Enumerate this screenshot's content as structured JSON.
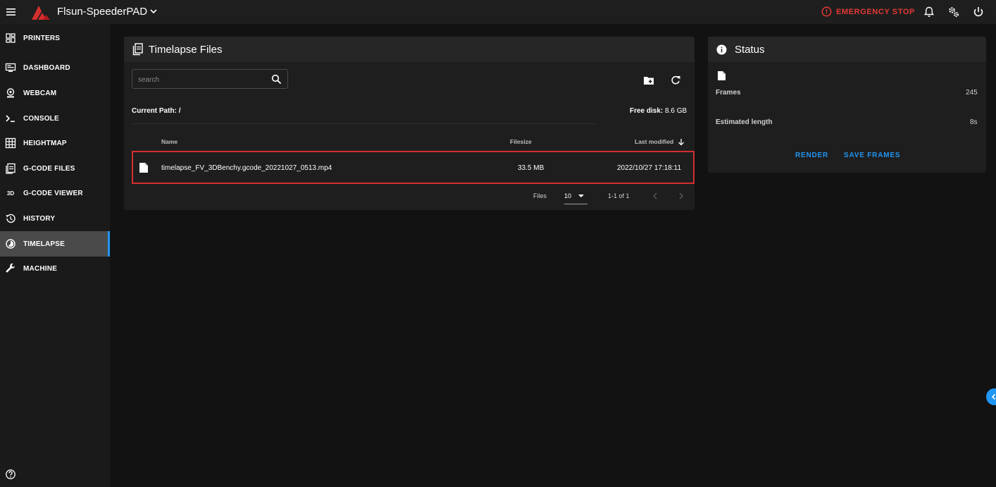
{
  "header": {
    "title": "Flsun-SpeederPAD",
    "emergency_stop": "EMERGENCY STOP",
    "accent": "#2196f3",
    "danger": "#e53935"
  },
  "sidebar": {
    "items": [
      {
        "label": "PRINTERS",
        "icon": "printers-icon"
      },
      {
        "label": "DASHBOARD",
        "icon": "dashboard-icon"
      },
      {
        "label": "WEBCAM",
        "icon": "webcam-icon"
      },
      {
        "label": "CONSOLE",
        "icon": "console-icon"
      },
      {
        "label": "HEIGHTMAP",
        "icon": "heightmap-icon"
      },
      {
        "label": "G-CODE FILES",
        "icon": "gcode-files-icon"
      },
      {
        "label": "G-CODE VIEWER",
        "icon": "gcode-viewer-icon",
        "icon_text": "3D"
      },
      {
        "label": "HISTORY",
        "icon": "history-icon"
      },
      {
        "label": "TIMELAPSE",
        "icon": "timelapse-icon",
        "active": true
      },
      {
        "label": "MACHINE",
        "icon": "machine-icon"
      }
    ]
  },
  "timelapse": {
    "title": "Timelapse Files",
    "search_placeholder": "search",
    "current_path_label": "Current Path:",
    "current_path": "/",
    "free_disk_label": "Free disk:",
    "free_disk": "8.6 GB",
    "columns": {
      "name": "Name",
      "filesize": "Filesize",
      "last_modified": "Last modified"
    },
    "files": [
      {
        "name": "timelapse_FV_3DBenchy.gcode_20221027_0513.mp4",
        "size": "33.5 MB",
        "modified": "2022/10/27 17:18:11"
      }
    ],
    "footer": {
      "files_label": "Files",
      "per_page": "10",
      "range": "1-1 of 1"
    }
  },
  "status": {
    "title": "Status",
    "frames_label": "Frames",
    "frames_value": "245",
    "length_label": "Estimated length",
    "length_value": "8s",
    "render_label": "RENDER",
    "save_frames_label": "SAVE FRAMES"
  }
}
